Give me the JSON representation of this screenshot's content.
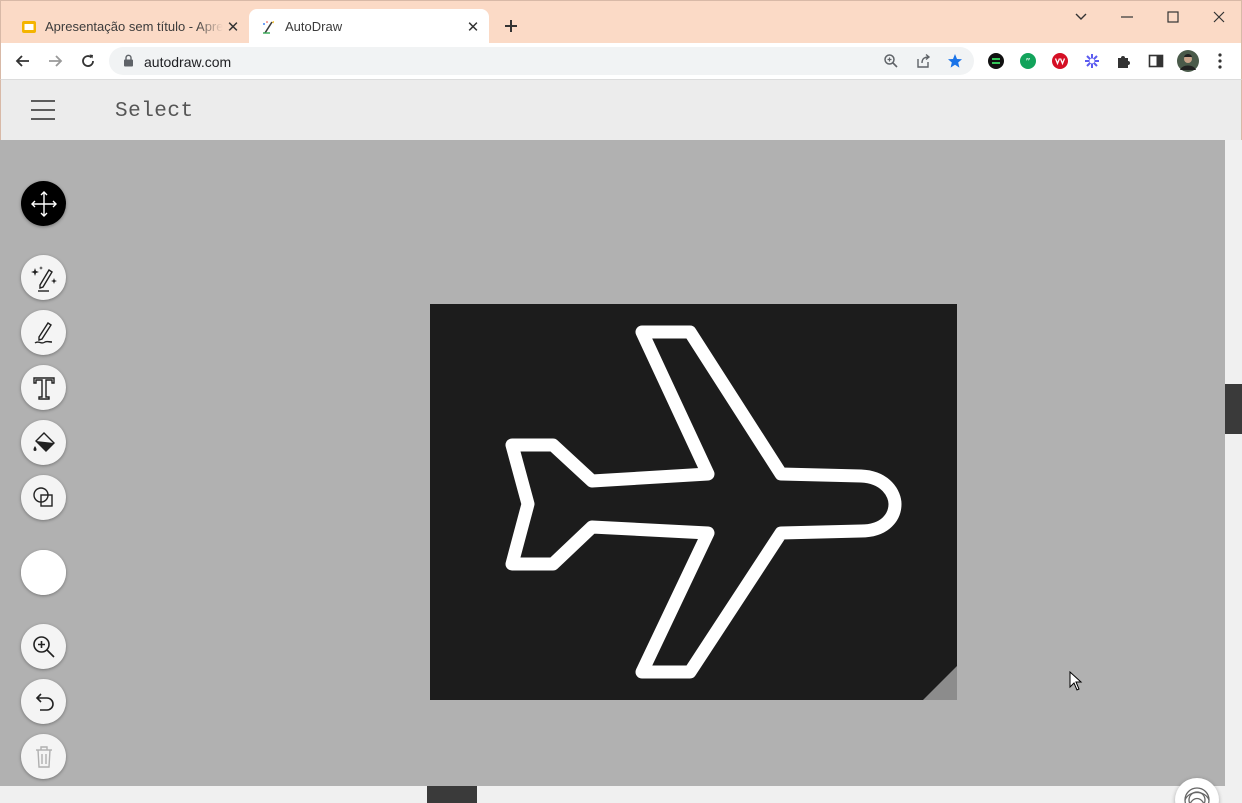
{
  "browser": {
    "tabs": [
      {
        "title": "Apresentação sem título - Apresentações Google",
        "favicon": "slides-icon",
        "active": false
      },
      {
        "title": "AutoDraw",
        "favicon": "autodraw-icon",
        "active": true
      }
    ],
    "address": "autodraw.com",
    "accent_tab_color": "#fbdac6"
  },
  "app": {
    "mode_title": "Select",
    "tools": [
      {
        "name": "select-tool",
        "icon": "move-arrows-icon",
        "active": true
      },
      {
        "name": "autodraw-tool",
        "icon": "magic-pen-icon"
      },
      {
        "name": "draw-tool",
        "icon": "pen-icon"
      },
      {
        "name": "type-tool",
        "icon": "text-icon"
      },
      {
        "name": "fill-tool",
        "icon": "paint-bucket-icon"
      },
      {
        "name": "shape-tool",
        "icon": "shapes-icon"
      },
      {
        "name": "color-picker",
        "icon": "color-swatch",
        "color": "#ffffff"
      },
      {
        "name": "zoom-tool",
        "icon": "zoom-in-icon"
      },
      {
        "name": "undo-button",
        "icon": "undo-icon"
      },
      {
        "name": "delete-button",
        "icon": "trash-icon",
        "disabled": true
      }
    ],
    "drawing": {
      "subject": "airplane-icon",
      "background": "#1c1c1c",
      "stroke": "#ffffff"
    }
  }
}
